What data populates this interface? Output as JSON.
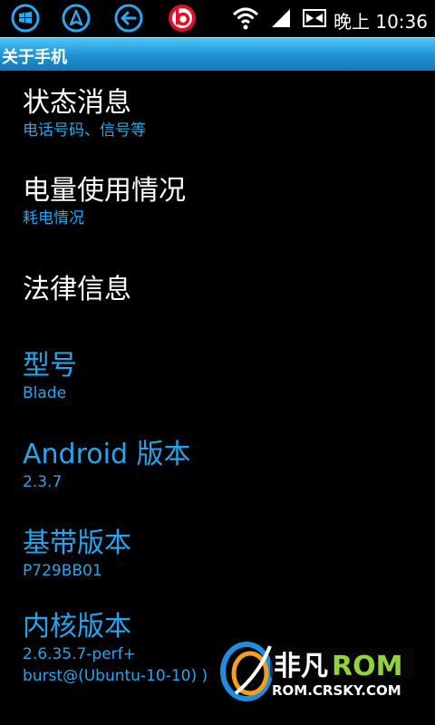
{
  "status_bar": {
    "icons": [
      "windows-start-icon",
      "navigation-icon",
      "back-icon",
      "beats-audio-icon",
      "wifi-icon",
      "signal-icon",
      "battery-icon"
    ],
    "time": "晚上 10:36"
  },
  "title": "关于手机",
  "items": [
    {
      "title": "状态消息",
      "subtitle": "电话号码、信号等"
    },
    {
      "title": "电量使用情况",
      "subtitle": "耗电情况"
    },
    {
      "title": "法律信息"
    },
    {
      "title": "型号",
      "subtitle": "Blade"
    },
    {
      "title": "Android 版本",
      "subtitle": "2.3.7"
    },
    {
      "title": "基带版本",
      "subtitle": "P729BB01"
    },
    {
      "title": "内核版本",
      "subtitle_line1": "2.6.35.7-perf+",
      "subtitle_line2": "burst@(Ubuntu-10-10) )"
    }
  ],
  "watermark": {
    "brand": "非凡ROM",
    "url": "ROM.CRSKY.COM"
  },
  "colors": {
    "accent": "#23a6ef",
    "title_bar": "#1e90d4",
    "background": "#000000"
  }
}
